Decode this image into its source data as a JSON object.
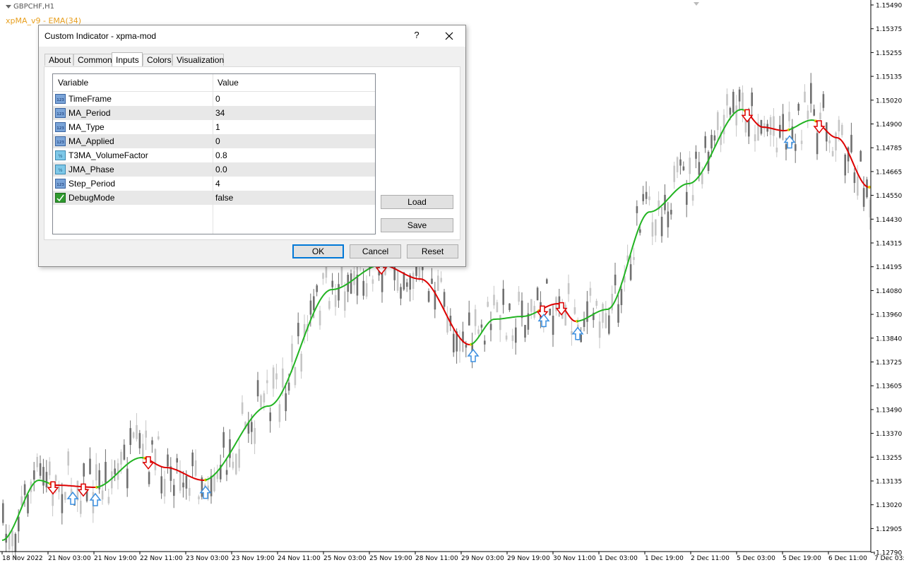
{
  "chart": {
    "symbol_title": "GBPCHF,H1",
    "indicator_label": "xpMA_v9 - EMA(34)",
    "price_labels": [
      "1.15490",
      "1.15375",
      "1.15255",
      "1.15135",
      "1.15020",
      "1.14900",
      "1.14785",
      "1.14665",
      "1.14550",
      "1.14430",
      "1.14315",
      "1.14195",
      "1.14080",
      "1.13960",
      "1.13840",
      "1.13725",
      "1.13605",
      "1.13490",
      "1.13370",
      "1.13255",
      "1.13135",
      "1.13020",
      "1.12905",
      "1.12790"
    ],
    "time_labels": [
      "18 Nov 2022",
      "21 Nov 03:00",
      "21 Nov 19:00",
      "22 Nov 11:00",
      "23 Nov 03:00",
      "23 Nov 19:00",
      "24 Nov 11:00",
      "25 Nov 03:00",
      "25 Nov 19:00",
      "28 Nov 11:00",
      "29 Nov 03:00",
      "29 Nov 19:00",
      "30 Nov 11:00",
      "1 Dec 03:00",
      "1 Dec 19:00",
      "2 Dec 11:00",
      "5 Dec 03:00",
      "5 Dec 19:00",
      "6 Dec 11:00",
      "7 Dec 03:00"
    ],
    "colors": {
      "uptrend": "#22b422",
      "downtrend": "#dd0000",
      "transition": "#e8c800",
      "candle_dark": "#707070",
      "candle_light": "#c6c6c6",
      "arrow_down": "#dd0000",
      "arrow_up": "#3b8fe0"
    }
  },
  "dialog": {
    "title": "Custom Indicator - xpma-mod",
    "help_label": "?",
    "close_icon": "close-icon",
    "tabs": [
      {
        "label": "About"
      },
      {
        "label": "Common"
      },
      {
        "label": "Inputs"
      },
      {
        "label": "Colors"
      },
      {
        "label": "Visualization"
      }
    ],
    "active_tab": "Inputs",
    "table": {
      "col_variable": "Variable",
      "col_value": "Value",
      "rows": [
        {
          "name": "TimeFrame",
          "value": "0",
          "icon": "integer-param-icon"
        },
        {
          "name": "MA_Period",
          "value": "34",
          "icon": "integer-param-icon"
        },
        {
          "name": "MA_Type",
          "value": "1",
          "icon": "integer-param-icon"
        },
        {
          "name": "MA_Applied",
          "value": "0",
          "icon": "integer-param-icon"
        },
        {
          "name": "T3MA_VolumeFactor",
          "value": "0.8",
          "icon": "double-param-icon"
        },
        {
          "name": "JMA_Phase",
          "value": "0.0",
          "icon": "double-param-icon"
        },
        {
          "name": "Step_Period",
          "value": "4",
          "icon": "integer-param-icon"
        },
        {
          "name": "DebugMode",
          "value": "false",
          "icon": "bool-param-icon"
        }
      ]
    },
    "load_label": "Load",
    "save_label": "Save",
    "ok_label": "OK",
    "cancel_label": "Cancel",
    "reset_label": "Reset"
  }
}
